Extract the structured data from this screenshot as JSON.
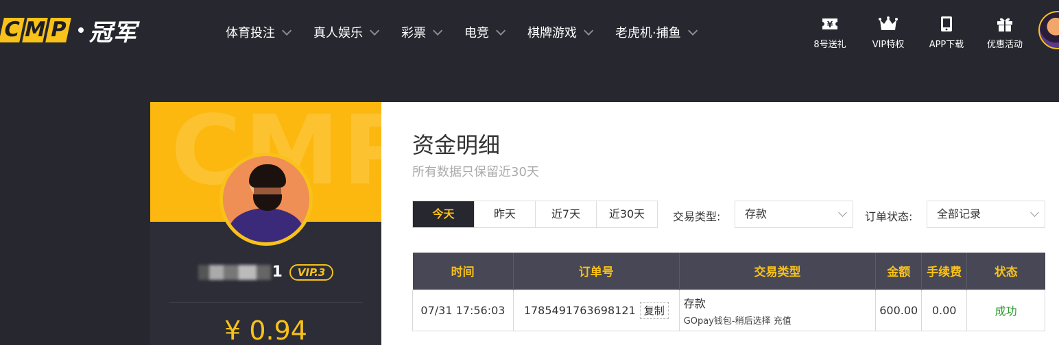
{
  "logo": {
    "letters": [
      "C",
      "M",
      "P"
    ],
    "cn": "冠军"
  },
  "nav": [
    {
      "label": "体育投注"
    },
    {
      "label": "真人娱乐"
    },
    {
      "label": "彩票"
    },
    {
      "label": "电竞"
    },
    {
      "label": "棋牌游戏"
    },
    {
      "label": "老虎机·捕鱼"
    }
  ],
  "top_links": [
    {
      "label": "8号送礼",
      "icon": "ticket-yen-icon"
    },
    {
      "label": "VIP特权",
      "icon": "crown-icon"
    },
    {
      "label": "APP下载",
      "icon": "phone-icon"
    },
    {
      "label": "优惠活动",
      "icon": "gift-icon"
    }
  ],
  "profile": {
    "watermark": "CMP",
    "name_suffix": "1",
    "vip": "VIP.3",
    "balance": "¥ 0.94"
  },
  "page": {
    "title": "资金明细",
    "subtitle": "所有数据只保留近30天"
  },
  "date_tabs": [
    "今天",
    "昨天",
    "近7天",
    "近30天"
  ],
  "filters": {
    "type_label": "交易类型:",
    "type_value": "存款",
    "status_label": "订单状态:",
    "status_value": "全部记录"
  },
  "table": {
    "headers": [
      "时间",
      "订单号",
      "交易类型",
      "金额",
      "手续费",
      "状态"
    ],
    "rows": [
      {
        "time": "07/31 17:56:03",
        "order": "1785491763698121",
        "copy": "复制",
        "type": "存款",
        "type_detail": "GOpay钱包-稍后选择 充值",
        "amount": "600.00",
        "fee": "0.00",
        "status": "成功"
      }
    ]
  },
  "colors": {
    "accent": "#f8c21a",
    "bg": "#272730",
    "success": "#2e9b2e"
  }
}
